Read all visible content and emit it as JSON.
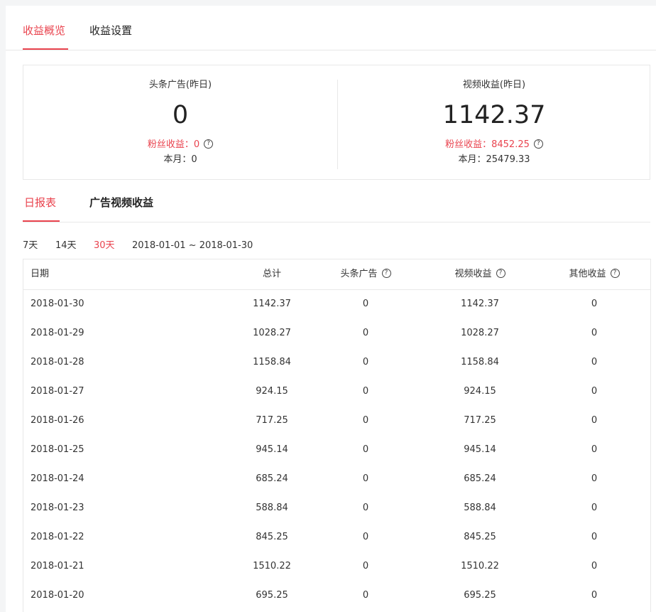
{
  "top_tabs": [
    {
      "label": "收益概览"
    },
    {
      "label": "收益设置"
    }
  ],
  "summary": {
    "left": {
      "title": "头条广告(昨日)",
      "value": "0",
      "fans": "粉丝收益：0",
      "month": "本月：0"
    },
    "right": {
      "title": "视频收益(昨日)",
      "value": "1142.37",
      "fans": "粉丝收益：8452.25",
      "month": "本月：25479.33"
    },
    "help_glyph": "?"
  },
  "sub_tabs": [
    {
      "label": "日报表"
    },
    {
      "label": "广告视频收益"
    }
  ],
  "range": {
    "options": [
      "7天",
      "14天",
      "30天"
    ],
    "selected": "30天",
    "dates": "2018-01-01  ~  2018-01-30"
  },
  "table": {
    "headers": [
      "日期",
      "总计",
      "头条广告",
      "视频收益",
      "其他收益"
    ],
    "rows": [
      [
        "2018-01-30",
        "1142.37",
        "0",
        "1142.37",
        "0"
      ],
      [
        "2018-01-29",
        "1028.27",
        "0",
        "1028.27",
        "0"
      ],
      [
        "2018-01-28",
        "1158.84",
        "0",
        "1158.84",
        "0"
      ],
      [
        "2018-01-27",
        "924.15",
        "0",
        "924.15",
        "0"
      ],
      [
        "2018-01-26",
        "717.25",
        "0",
        "717.25",
        "0"
      ],
      [
        "2018-01-25",
        "945.14",
        "0",
        "945.14",
        "0"
      ],
      [
        "2018-01-24",
        "685.24",
        "0",
        "685.24",
        "0"
      ],
      [
        "2018-01-23",
        "588.84",
        "0",
        "588.84",
        "0"
      ],
      [
        "2018-01-22",
        "845.25",
        "0",
        "845.25",
        "0"
      ],
      [
        "2018-01-21",
        "1510.22",
        "0",
        "1510.22",
        "0"
      ],
      [
        "2018-01-20",
        "695.25",
        "0",
        "695.25",
        "0"
      ]
    ]
  },
  "colors": {
    "accent": "#e9434e",
    "border": "#e8e8e8",
    "page_bg": "#f4f5f6"
  },
  "icons": {
    "help": "question-circle-icon"
  }
}
